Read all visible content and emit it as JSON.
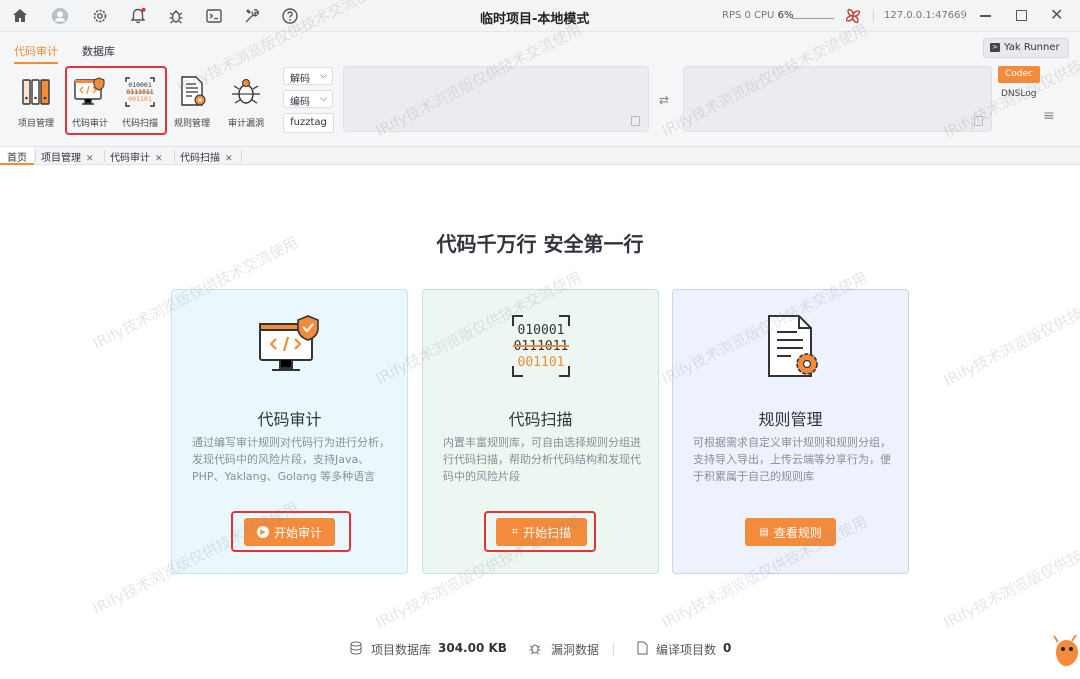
{
  "window": {
    "title": "临时项目-本地模式",
    "rps_label": "RPS 0 CPU",
    "cpu_value": "6%",
    "address": "127.0.0.1:47669"
  },
  "titlebar_icons": [
    "home-icon",
    "user-avatar-icon",
    "gear-icon",
    "bell-icon",
    "bug-icon",
    "terminal-icon",
    "tools-icon",
    "help-icon"
  ],
  "ribbon": {
    "tabs": [
      "代码审计",
      "数据库"
    ],
    "tools": [
      {
        "label": "项目管理",
        "icon": "project-manage-icon"
      },
      {
        "label": "代码审计",
        "icon": "code-audit-icon"
      },
      {
        "label": "代码扫描",
        "icon": "code-scan-icon"
      },
      {
        "label": "规则管理",
        "icon": "rule-manage-icon"
      },
      {
        "label": "审计漏洞",
        "icon": "audit-bug-icon"
      }
    ],
    "decode_label": "解码",
    "encode_label": "编码",
    "fuzztag_label": "fuzztag",
    "yak_runner_label": "Yak Runner",
    "codec_label": "Codec",
    "dnslog_label": "DNSLog"
  },
  "tabs": [
    {
      "label": "首页",
      "closable": false
    },
    {
      "label": "项目管理",
      "closable": true
    },
    {
      "label": "代码审计",
      "closable": true
    },
    {
      "label": "代码扫描",
      "closable": true
    }
  ],
  "main": {
    "headline": "代码千万行 安全第一行",
    "cards": [
      {
        "title": "代码审计",
        "desc": "通过编写审计规则对代码行为进行分析，发现代码中的风险片段，支持Java、PHP、Yaklang、Golang 等多种语言",
        "button": "开始审计",
        "icon": "code-audit-icon",
        "bg": "#eaf8fd"
      },
      {
        "title": "代码扫描",
        "desc": "内置丰富规则库，可自由选择规则分组进行代码扫描，帮助分析代码结构和发现代码中的风险片段",
        "button": "开始扫描",
        "icon": "code-scan-icon",
        "bg": "#edf7f1"
      },
      {
        "title": "规则管理",
        "desc": "可根据需求自定义审计规则和规则分组，支持导入导出，上传云端等分享行为，便于积累属于自己的规则库",
        "button": "查看规则",
        "icon": "rule-manage-icon",
        "bg": "#edf2fd"
      }
    ],
    "scan_binary": [
      "010001",
      "0111011",
      "001101"
    ]
  },
  "footer": {
    "db_label": "项目数据库",
    "db_size": "304.00 KB",
    "vuln_label": "漏洞数据",
    "compile_label": "编译项目数",
    "compile_count": "0"
  },
  "watermark": "IRify技术浏览版仅供技术交流使用",
  "colors": {
    "accent": "#f28b3c",
    "highlight": "#e3323b"
  }
}
